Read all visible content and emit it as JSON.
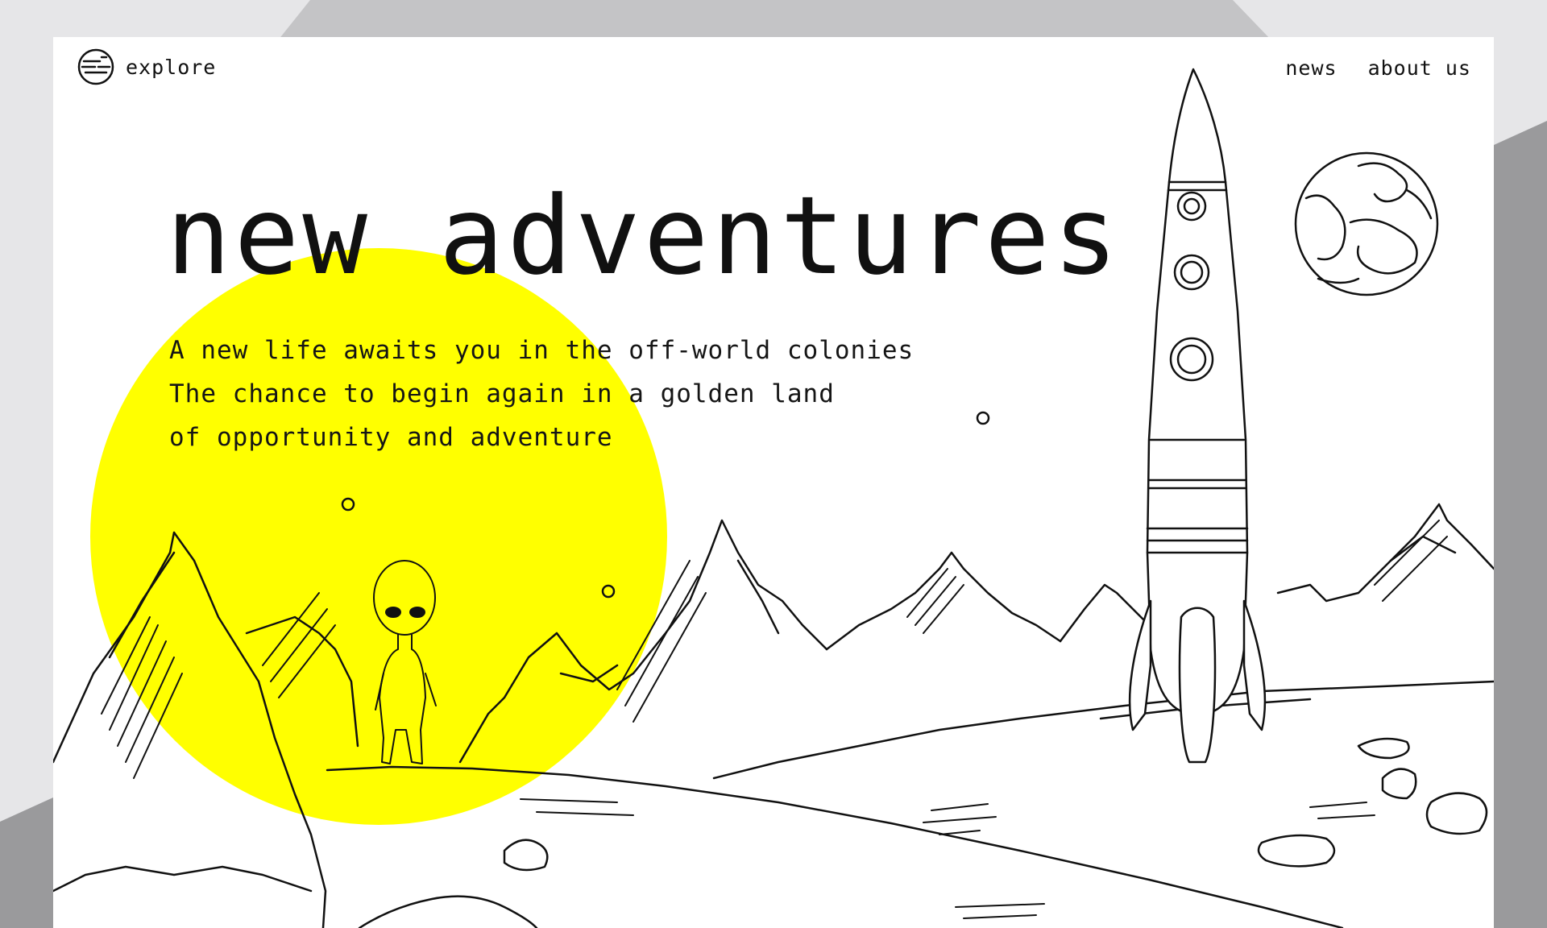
{
  "header": {
    "logo_text": "explore",
    "logo_icon": "planet-logo-icon",
    "nav": [
      {
        "label": "news"
      },
      {
        "label": "about us"
      }
    ]
  },
  "hero": {
    "title": "new adventures",
    "lines": [
      "A new life awaits you in the off-world colonies",
      "The chance to begin again in a golden land",
      "of opportunity and adventure"
    ]
  },
  "colors": {
    "accent": "#ffff00",
    "ink": "#111111",
    "page": "#ffffff",
    "backdrop": "#e6e6e8"
  }
}
